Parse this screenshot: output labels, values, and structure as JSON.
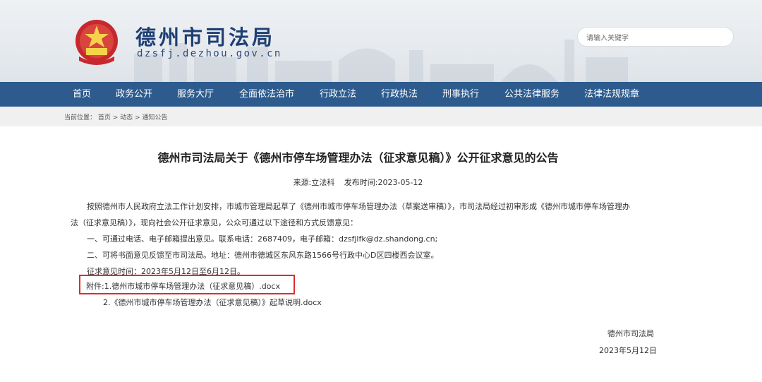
{
  "header": {
    "site_title": "德州市司法局",
    "site_domain": "dzsfj.dezhou.gov.cn",
    "search_placeholder": "请输入关键字"
  },
  "nav": {
    "items": [
      "首页",
      "政务公开",
      "服务大厅",
      "全面依法治市",
      "行政立法",
      "行政执法",
      "刑事执行",
      "公共法律服务",
      "法律法规规章"
    ]
  },
  "breadcrumb": {
    "text": "当前位置： 首页 > 动态 > 通知公告"
  },
  "article": {
    "title": "德州市司法局关于《德州市停车场管理办法（征求意见稿）》公开征求意见的公告",
    "source": "来源:立法科",
    "publish_time": "发布时间:2023-05-12",
    "para1_line1": "按照德州市人民政府立法工作计划安排，市城市管理局起草了《德州市城市停车场管理办法（草案送审稿）》，市司法局经过初审形成《德州市城市停车场管理办",
    "para1_line2": "法（征求意见稿）》，现向社会公开征求意见，公众可通过以下途径和方式反馈意见：",
    "item1": "一、可通过电话、电子邮箱提出意见。联系电话：2687409，电子邮箱：dzsfjlfk@dz.shandong.cn;",
    "item2": "二、可将书面意见反馈至市司法局。地址：德州市德城区东风东路1566号行政中心D区四楼西会议室。",
    "deadline": "征求意见时间：2023年5月12日至6月12日。",
    "attachment_label": "附件:",
    "attachment1": "1.德州市城市停车场管理办法（征求意见稿）.docx",
    "attachment2": "2.《德州市城市停车场管理办法（征求意见稿）》起草说明.docx",
    "signature": "德州市司法局",
    "date": "2023年5月12日"
  },
  "colors": {
    "nav_bg": "#2d5b8e",
    "title_blue": "#1f3f73",
    "highlight_red": "#e02b2b"
  }
}
